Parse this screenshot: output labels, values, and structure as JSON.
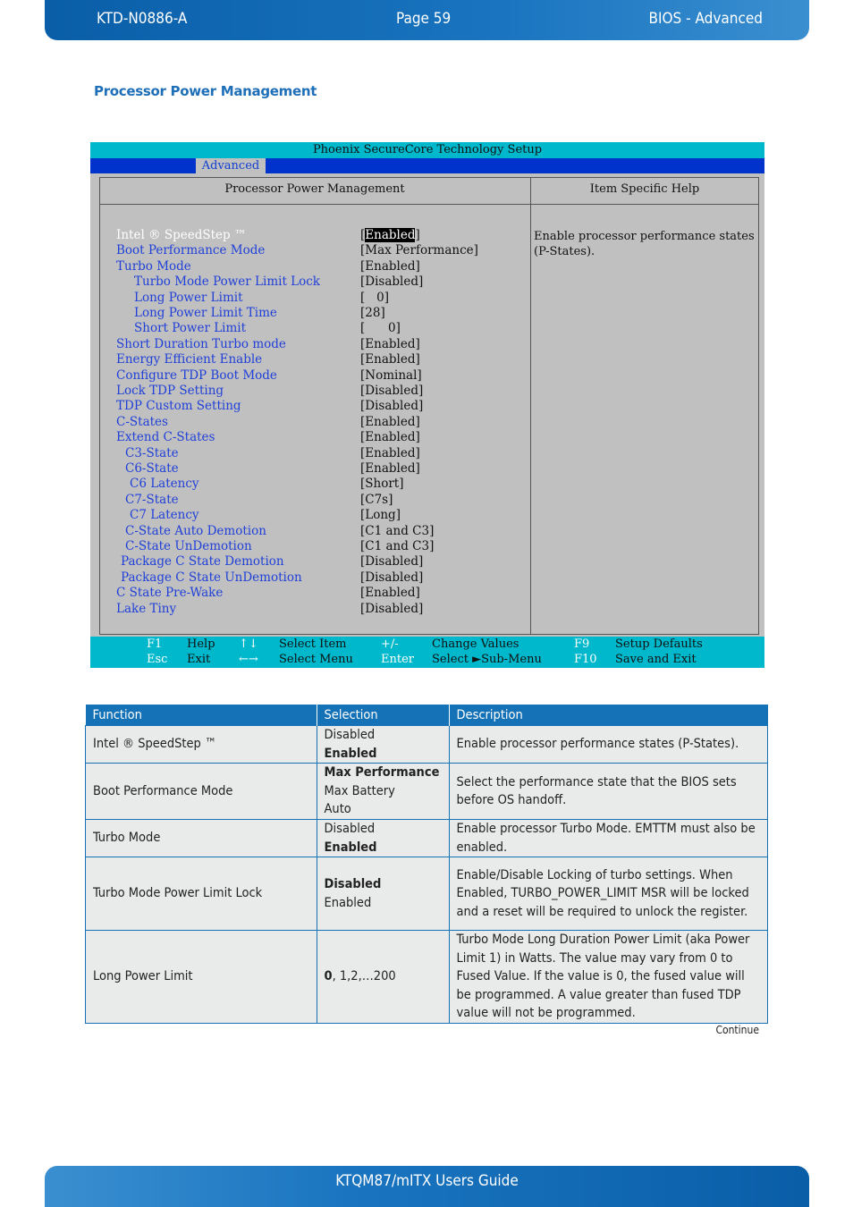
{
  "header": {
    "doc_id": "KTD-N0886-A",
    "page": "Page 59",
    "section": "BIOS  - Advanced"
  },
  "section_title": "Processor Power Management",
  "bios": {
    "title": "Phoenix SecureCore Technology Setup",
    "active_tab": "Advanced",
    "panel_title": "Processor Power Management",
    "help_title": "Item Specific Help",
    "help_text": "Enable processor performance states (P-States).",
    "items": [
      {
        "label": "Intel ® SpeedStep ™",
        "value": "Enabled",
        "selected": true,
        "indent": 0
      },
      {
        "label": "Boot Performance Mode",
        "value": "[Max Performance]",
        "indent": 0
      },
      {
        "label": "Turbo Mode",
        "value": "[Enabled]",
        "indent": 0
      },
      {
        "label": "Turbo Mode Power Limit Lock",
        "value": "[Disabled]",
        "indent": 2
      },
      {
        "label": "Long Power Limit",
        "value": "[   0]",
        "indent": 2
      },
      {
        "label": "Long Power Limit Time",
        "value": "[28]",
        "indent": 2
      },
      {
        "label": "Short Power Limit",
        "value": "[      0]",
        "indent": 2
      },
      {
        "label": "Short Duration Turbo mode",
        "value": "[Enabled]",
        "indent": 0
      },
      {
        "label": "Energy Efficient Enable",
        "value": "[Enabled]",
        "indent": 0
      },
      {
        "label": "Configure TDP Boot Mode",
        "value": "[Nominal]",
        "indent": 0
      },
      {
        "label": "Lock TDP Setting",
        "value": "[Disabled]",
        "indent": 0
      },
      {
        "label": "TDP Custom Setting",
        "value": "[Disabled]",
        "indent": 0
      },
      {
        "label": "C-States",
        "value": "[Enabled]",
        "indent": 0
      },
      {
        "label": "Extend C-States",
        "value": "[Enabled]",
        "indent": 0
      },
      {
        "label": "C3-State",
        "value": "[Enabled]",
        "indent": 1
      },
      {
        "label": "C6-State",
        "value": "[Enabled]",
        "indent": 1
      },
      {
        "label": "C6 Latency",
        "value": "[Short]",
        "indent": 1.5
      },
      {
        "label": "C7-State",
        "value": "[C7s]",
        "indent": 1
      },
      {
        "label": "C7 Latency",
        "value": "[Long]",
        "indent": 1.5
      },
      {
        "label": "C-State Auto Demotion",
        "value": "[C1 and C3]",
        "indent": 1
      },
      {
        "label": "C-State UnDemotion",
        "value": "[C1 and C3]",
        "indent": 1
      },
      {
        "label": "Package C State Demotion",
        "value": "[Disabled]",
        "indent": 0.5
      },
      {
        "label": "Package C State UnDemotion",
        "value": "[Disabled]",
        "indent": 0.5
      },
      {
        "label": "C State Pre-Wake",
        "value": "[Enabled]",
        "indent": 0
      },
      {
        "label": "Lake Tiny",
        "value": "[Disabled]",
        "indent": 0
      }
    ],
    "footer": [
      {
        "key": "F1",
        "desc": "Help"
      },
      {
        "key": "↑↓",
        "desc": "Select Item"
      },
      {
        "key": "+/-",
        "desc": "Change Values"
      },
      {
        "key": "F9",
        "desc": "Setup Defaults"
      },
      {
        "key": "Esc",
        "desc": "Exit"
      },
      {
        "key": "←→",
        "desc": "Select Menu"
      },
      {
        "key": "Enter",
        "desc": "Select ►Sub-Menu"
      },
      {
        "key": "F10",
        "desc": "Save and Exit"
      }
    ]
  },
  "table": {
    "headers": [
      "Function",
      "Selection",
      "Description"
    ],
    "rows": [
      {
        "function": "Intel ® SpeedStep ™",
        "options": [
          {
            "text": "Disabled",
            "default": false
          },
          {
            "text": "Enabled",
            "default": true
          }
        ],
        "description": "Enable processor performance states (P-States)."
      },
      {
        "function": "Boot Performance Mode",
        "options": [
          {
            "text": "Max Performance",
            "default": true
          },
          {
            "text": "Max Battery",
            "default": false
          },
          {
            "text": "Auto",
            "default": false
          }
        ],
        "description": "Select the performance state that the BIOS sets before OS handoff."
      },
      {
        "function": "Turbo Mode",
        "options": [
          {
            "text": "Disabled",
            "default": false
          },
          {
            "text": "Enabled",
            "default": true
          }
        ],
        "description": "Enable processor Turbo Mode. EMTTM must also be enabled."
      },
      {
        "function": "Turbo Mode Power Limit Lock",
        "options": [
          {
            "text": "Disabled",
            "default": true
          },
          {
            "text": "Enabled",
            "default": false
          }
        ],
        "description": "Enable/Disable Locking of turbo settings. When Enabled, TURBO_POWER_LIMIT MSR will be locked and a reset will be required to unlock the register."
      },
      {
        "function": "Long Power Limit",
        "range": {
          "default": "0",
          "rest": ", 1,2,…200"
        },
        "description": "Turbo Mode Long Duration Power Limit (aka Power Limit 1) in Watts. The value may vary from 0 to Fused Value. If the value is 0, the fused value will be programmed. A value greater than fused TDP value will not be programmed."
      }
    ],
    "continue_label": "Continue"
  },
  "footer": {
    "title": "KTQM87/mITX Users Guide"
  }
}
